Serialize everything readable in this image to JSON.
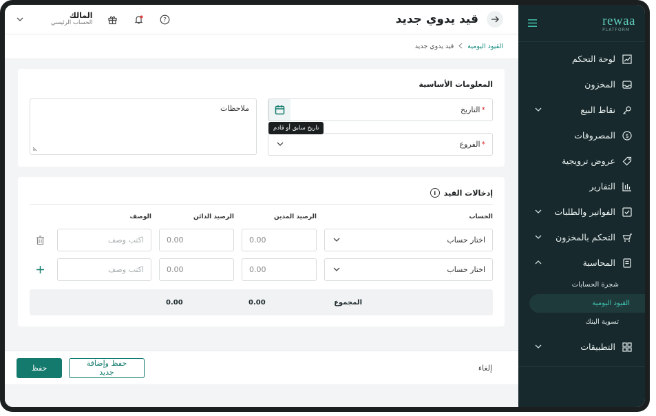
{
  "brand": {
    "logo_text": "rewaa",
    "logo_sub": "PLATFORM"
  },
  "sidebar": {
    "items": [
      {
        "label": "لوحة التحكم",
        "icon": "chart-line-icon",
        "expandable": false
      },
      {
        "label": "المخزون",
        "icon": "inbox-icon",
        "expandable": false
      },
      {
        "label": "نقاط البيع",
        "icon": "key-icon",
        "expandable": true
      },
      {
        "label": "المصروفات",
        "icon": "dollar-circle-icon",
        "expandable": false
      },
      {
        "label": "عروض ترويجية",
        "icon": "tag-icon",
        "expandable": false
      },
      {
        "label": "التقارير",
        "icon": "bar-chart-icon",
        "expandable": false
      },
      {
        "label": "الفواتير والطلبات",
        "icon": "check-square-icon",
        "expandable": true
      },
      {
        "label": "التحكم بالمخزون",
        "icon": "cart-icon",
        "expandable": true
      },
      {
        "label": "المحاسبة",
        "icon": "ledger-icon",
        "expandable": true,
        "expanded": true
      }
    ],
    "sub_items": [
      "شجرة الحسابات",
      "القيود اليومية",
      "تسوية البنك"
    ],
    "active_sub": "القيود اليومية",
    "apps": {
      "label": "التطبيقات",
      "icon": "grid-icon"
    }
  },
  "topbar": {
    "title": "قيد يدوي جديد",
    "owner_name": "المالك",
    "owner_sub": "الحساب الرئيسي"
  },
  "breadcrumb": {
    "parent": "القيود اليومية",
    "current": "قيد يدوي جديد"
  },
  "basic_info": {
    "title": "المعلومات الأساسية",
    "date_label": "التاريخ",
    "date_tooltip": "تاريخ سابق أو قادم",
    "branch_label": "الفروع",
    "notes_label": "ملاحظات"
  },
  "entries": {
    "title": "إدخالات القيد",
    "columns": {
      "account": "الحساب",
      "debit": "الرصيد المدين",
      "credit": "الرصيد الدائن",
      "description": "الوصف"
    },
    "rows": [
      {
        "account": "اختار حساب",
        "debit": "0.00",
        "credit": "0.00",
        "description_placeholder": "اكتب وصف"
      },
      {
        "account": "اختار حساب",
        "debit": "0.00",
        "credit": "0.00",
        "description_placeholder": "اكتب وصف"
      }
    ],
    "total_label": "المجموع",
    "total_debit": "0.00",
    "total_credit": "0.00"
  },
  "footer": {
    "cancel": "إلغاء",
    "save_add": "حفظ وإضافة جديد",
    "save": "حفظ"
  },
  "colors": {
    "sidebar_bg": "#17292c",
    "accent": "#137a6d",
    "accent_light": "#3fc4b0"
  }
}
